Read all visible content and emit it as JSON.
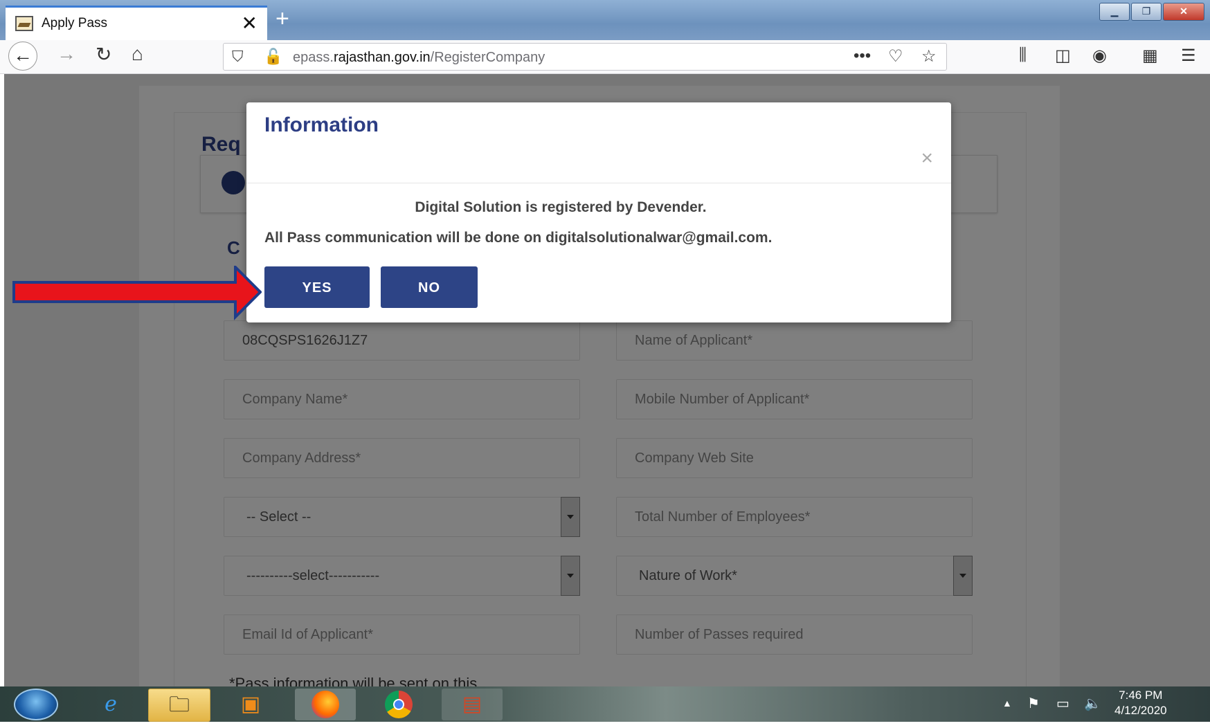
{
  "browser": {
    "tab_title": "Apply Pass",
    "tab_close": "✕",
    "new_tab": "+",
    "url_host": "epass.rajasthan.gov.in",
    "url_prefix": "epass.",
    "url_domain": "rajasthan.gov.in",
    "url_path": "/RegisterCompany",
    "url_menu": "•••"
  },
  "page": {
    "heading_fragment": "Req",
    "section_fragment": "C",
    "fields": {
      "gst": "08CQSPS1626J1Z7",
      "name_applicant": "Name of Applicant*",
      "company_name": "Company Name*",
      "mobile": "Mobile Number  of Applicant*",
      "company_address": "Company Address*",
      "website": "Company Web Site",
      "select1": "-- Select --",
      "employees": "Total Number of Employees*",
      "select2": "----------select-----------",
      "nature_of_work": "Nature of Work*",
      "email": "Email Id of Applicant*",
      "passes": "Number of Passes required"
    },
    "note": "*Pass information will be sent on this"
  },
  "modal": {
    "title": "Information",
    "close": "×",
    "line1": "Digital Solution is registered by Devender.",
    "line2": "All Pass communication will be done on digitalsolutionalwar@gmail.com.",
    "yes": "YES",
    "no": "NO"
  },
  "taskbar": {
    "time": "7:46 PM",
    "date": "4/12/2020"
  },
  "colors": {
    "modal_title": "#2d3e84",
    "button": "#2d4486",
    "arrow": "#e8141b",
    "arrow_outline": "#1f3c8a"
  }
}
